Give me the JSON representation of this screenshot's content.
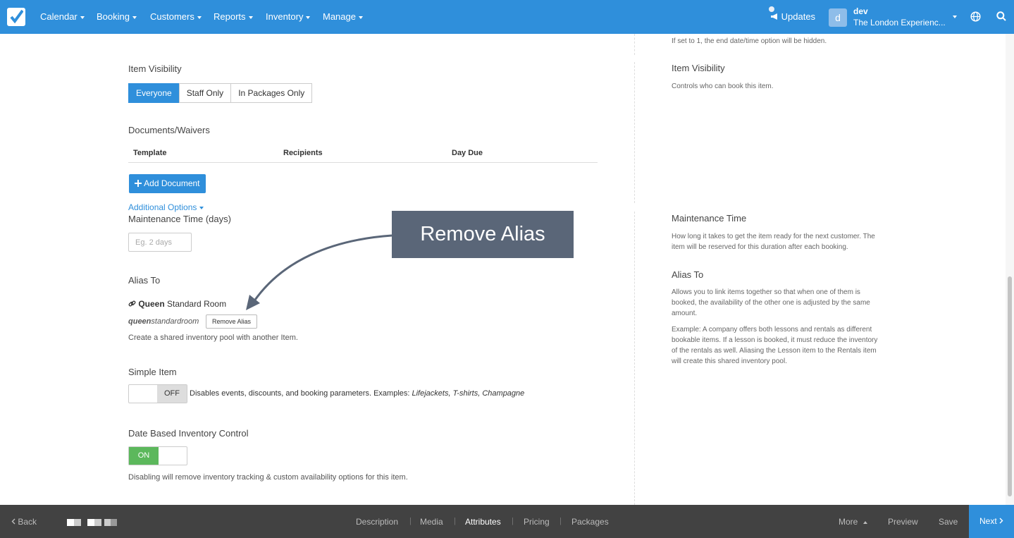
{
  "topnav": {
    "menu": [
      "Calendar",
      "Booking",
      "Customers",
      "Reports",
      "Inventory",
      "Manage"
    ],
    "updates_label": "Updates",
    "avatar_letter": "d",
    "user_name": "dev",
    "user_org": "The London Experienc..."
  },
  "main": {
    "item_visibility": {
      "title": "Item Visibility",
      "options": [
        "Everyone",
        "Staff Only",
        "In Packages Only"
      ],
      "selected": "Everyone"
    },
    "documents": {
      "title": "Documents/Waivers",
      "columns": [
        "Template",
        "Recipients",
        "Day Due"
      ],
      "add_button": "Add Document"
    },
    "additional_options": "Additional Options",
    "maintenance": {
      "title": "Maintenance Time (days)",
      "placeholder": "Eg. 2 days"
    },
    "alias": {
      "title": "Alias To",
      "linked_bold": "Queen",
      "linked_rest": "Standard Room",
      "slug_bold": "queen",
      "slug_rest": "standardroom",
      "remove_button": "Remove Alias",
      "help": "Create a shared inventory pool with another Item."
    },
    "simple_item": {
      "title": "Simple Item",
      "toggle_label": "OFF",
      "description": "Disables events, discounts, and booking parameters. Examples: ",
      "examples": "Lifejackets, T-shirts, Champagne"
    },
    "date_inventory": {
      "title": "Date Based Inventory Control",
      "toggle_label": "ON",
      "help": "Disabling will remove inventory tracking & custom availability options for this item."
    }
  },
  "sidebar": {
    "top_note": "If set to 1, the end date/time option will be hidden.",
    "visibility_title": "Item Visibility",
    "visibility_text": "Controls who can book this item.",
    "maintenance_title": "Maintenance Time",
    "maintenance_text": "How long it takes to get the item ready for the next customer. The item will be reserved for this duration after each booking.",
    "alias_title": "Alias To",
    "alias_text": "Allows you to link items together so that when one of them is booked, the availability of the other one is adjusted by the same amount.",
    "alias_example": "Example: A company offers both lessons and rentals as different bookable items. If a lesson is booked, it must reduce the inventory of the rentals as well. Aliasing the Lesson item to the Rentals item will create this shared inventory pool."
  },
  "callout": {
    "text": "Remove Alias"
  },
  "bottombar": {
    "back": "Back",
    "tabs": [
      "Description",
      "Media",
      "Attributes",
      "Pricing",
      "Packages"
    ],
    "active_tab": "Attributes",
    "more": "More",
    "preview": "Preview",
    "save": "Save",
    "next": "Next"
  },
  "colors": {
    "primary": "#2f8fdb",
    "on": "#5cb85c",
    "bottombar": "#424242",
    "callout": "#5a6678"
  },
  "icons": [
    "checkmark-logo-icon",
    "megaphone-icon",
    "globe-icon",
    "search-icon",
    "link-icon",
    "plus-icon",
    "chevron-left-icon",
    "chevron-right-icon"
  ]
}
